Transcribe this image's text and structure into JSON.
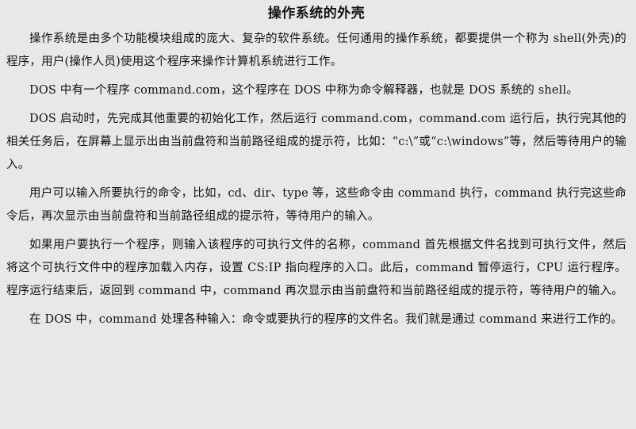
{
  "document": {
    "title": "操作系统的外壳",
    "paragraphs": [
      "操作系统是由多个功能模块组成的庞大、复杂的软件系统。任何通用的操作系统，都要提供一个称为 shell(外壳)的程序，用户(操作人员)使用这个程序来操作计算机系统进行工作。",
      "DOS 中有一个程序 command.com，这个程序在 DOS 中称为命令解释器，也就是 DOS 系统的 shell。",
      "DOS 启动时，先完成其他重要的初始化工作，然后运行 command.com，command.com 运行后，执行完其他的相关任务后，在屏幕上显示出由当前盘符和当前路径组成的提示符，比如：“c:\\”或“c:\\windows”等，然后等待用户的输入。",
      "用户可以输入所要执行的命令，比如，cd、dir、type 等，这些命令由 command 执行，command 执行完这些命令后，再次显示由当前盘符和当前路径组成的提示符，等待用户的输入。",
      "如果用户要执行一个程序，则输入该程序的可执行文件的名称，command 首先根据文件名找到可执行文件，然后将这个可执行文件中的程序加载入内存，设置 CS:IP 指向程序的入口。此后，command 暂停运行，CPU 运行程序。程序运行结束后，返回到 command 中，command 再次显示由当前盘符和当前路径组成的提示符，等待用户的输入。",
      "在 DOS 中，command 处理各种输入：命令或要执行的程序的文件名。我们就是通过 command 来进行工作的。"
    ]
  }
}
